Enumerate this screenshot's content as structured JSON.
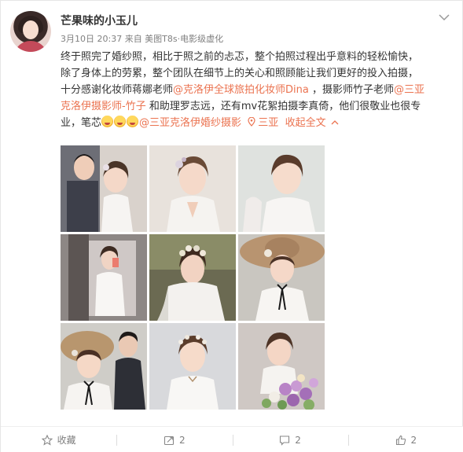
{
  "user": {
    "name": "芒果味的小玉儿"
  },
  "post": {
    "meta": "3月10日 20:37 来自 美图T8s·电影级虚化",
    "segments": {
      "l1": "终于照完了婚纱照，相比于照之前的忐忑，整个拍照过程出乎意料的轻松愉快，",
      "l2": "除了身体上的劳累，整个团队在细节上的关心和照顾能让我们更好的投入拍摄，",
      "l3_pre": "十分感谢化妆师蒋娜老师",
      "l3_link": "@克洛伊全球旅拍化妆师Dina",
      "l3_post": " ，摄影师竹子老师",
      "l3_link2": "@三亚",
      "l4_link": "克洛伊摄影师-竹子",
      "l4_post": " 和助理罗志远，还有mv花絮拍摄李真倚，他们很敬业也很专",
      "l5_pre": "业，笔芯",
      "l5_link": "@三亚克洛伊婚纱摄影",
      "location": "三亚",
      "collapse": "收起全文"
    },
    "emoji_count": 3,
    "photos": [
      {
        "desc": "couple-in-suit"
      },
      {
        "desc": "bride-looking-down"
      },
      {
        "desc": "bride-close-up"
      },
      {
        "desc": "bride-mirror-selfie"
      },
      {
        "desc": "bride-flower-crown"
      },
      {
        "desc": "bride-straw-hat"
      },
      {
        "desc": "couple-straw-hat"
      },
      {
        "desc": "bride-smiling"
      },
      {
        "desc": "bride-with-flowers"
      }
    ]
  },
  "actions": {
    "favorite": "收藏",
    "repost": "2",
    "comment": "2",
    "like": "2"
  },
  "colors": {
    "link": "#eb7350",
    "meta": "#808080",
    "text": "#333333"
  }
}
